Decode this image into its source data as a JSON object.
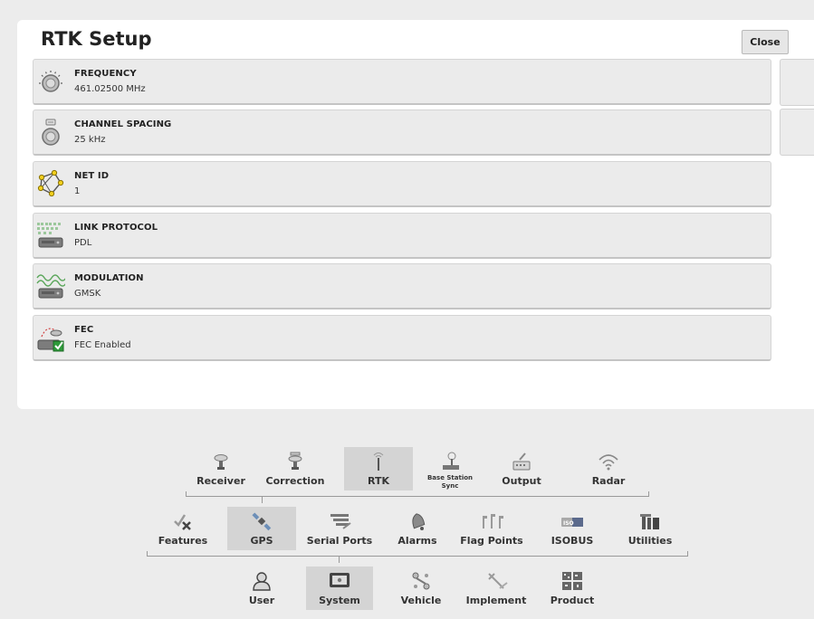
{
  "dialog": {
    "title": "RTK Setup",
    "close_label": "Close"
  },
  "settings": [
    {
      "label": "FREQUENCY",
      "value": "461.02500 MHz",
      "icon": "frequency-dial-icon"
    },
    {
      "label": "CHANNEL SPACING",
      "value": "25 kHz",
      "icon": "channel-spacing-dial-icon"
    },
    {
      "label": "NET ID",
      "value": "1",
      "icon": "network-id-icon"
    },
    {
      "label": "LINK PROTOCOL",
      "value": "PDL",
      "icon": "link-protocol-icon"
    },
    {
      "label": "MODULATION",
      "value": "GMSK",
      "icon": "modulation-wave-icon"
    },
    {
      "label": "FEC",
      "value": "FEC Enabled",
      "icon": "fec-enabled-icon"
    }
  ],
  "nav": {
    "gps_tabs": [
      {
        "label": "Receiver",
        "icon": "receiver-antenna-icon"
      },
      {
        "label": "Correction",
        "icon": "correction-antenna-icon"
      },
      {
        "label": "RTK",
        "icon": "rtk-radio-icon",
        "active": true
      },
      {
        "label": "Base Station Sync",
        "icon": "base-station-icon"
      },
      {
        "label": "Output",
        "icon": "output-icon"
      },
      {
        "label": "Radar",
        "icon": "radar-wifi-icon"
      }
    ],
    "system_tabs": [
      {
        "label": "Features",
        "icon": "features-icon"
      },
      {
        "label": "GPS",
        "icon": "gps-satellite-icon",
        "active": true
      },
      {
        "label": "Serial Ports",
        "icon": "serial-ports-icon"
      },
      {
        "label": "Alarms",
        "icon": "alarm-bell-icon"
      },
      {
        "label": "Flag Points",
        "icon": "flag-points-icon"
      },
      {
        "label": "ISOBUS",
        "icon": "isobus-icon"
      },
      {
        "label": "Utilities",
        "icon": "utilities-icon"
      }
    ],
    "main_tabs": [
      {
        "label": "User",
        "icon": "user-icon"
      },
      {
        "label": "System",
        "icon": "system-display-icon",
        "active": true
      },
      {
        "label": "Vehicle",
        "icon": "vehicle-icon"
      },
      {
        "label": "Implement",
        "icon": "implement-icon"
      },
      {
        "label": "Product",
        "icon": "product-icon"
      }
    ]
  },
  "colors": {
    "accent_yellow": "#f2cf1d",
    "check_green": "#2e9a3a",
    "active_tab_bg": "#d4d4d4"
  }
}
